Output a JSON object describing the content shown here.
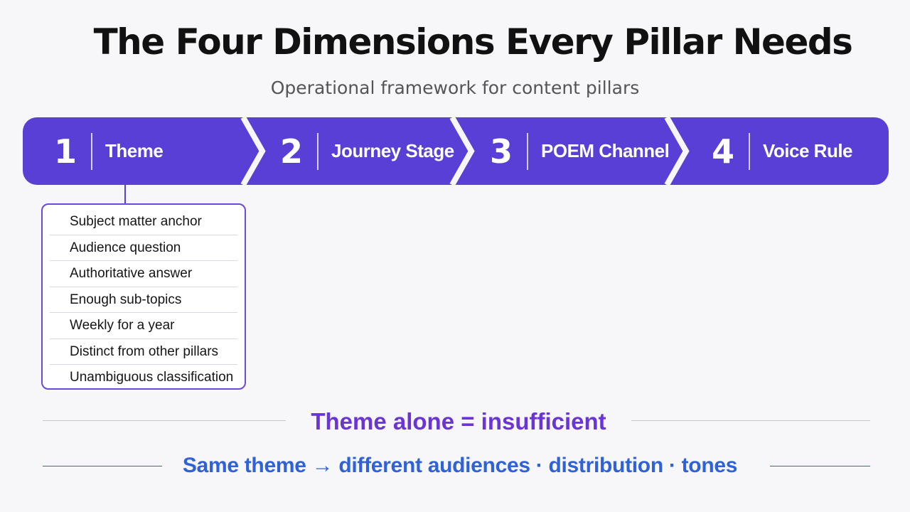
{
  "header": {
    "title": "The Four Dimensions Every Pillar Needs",
    "subtitle": "Operational framework for content pillars"
  },
  "colors": {
    "band": "#5a3fd6",
    "card_border": "#6a4ad8",
    "emphasis_purple": "#6a35d4",
    "emphasis_blue": "#2f62d8"
  },
  "steps": [
    {
      "number": "1",
      "label": "Theme"
    },
    {
      "number": "2",
      "label": "Journey Stage"
    },
    {
      "number": "3",
      "label": "POEM Channel"
    },
    {
      "number": "4",
      "label": "Voice Rule"
    }
  ],
  "theme_card": {
    "items": [
      "Subject matter anchor",
      "Audience question",
      "Authoritative answer",
      "Enough sub-topics",
      "Weekly for a year",
      "Distinct from other pillars",
      "Unambiguous classification"
    ]
  },
  "callouts": {
    "line1": "Theme alone = insufficient",
    "line2": "Same theme → different audiences · distribution · tones"
  }
}
